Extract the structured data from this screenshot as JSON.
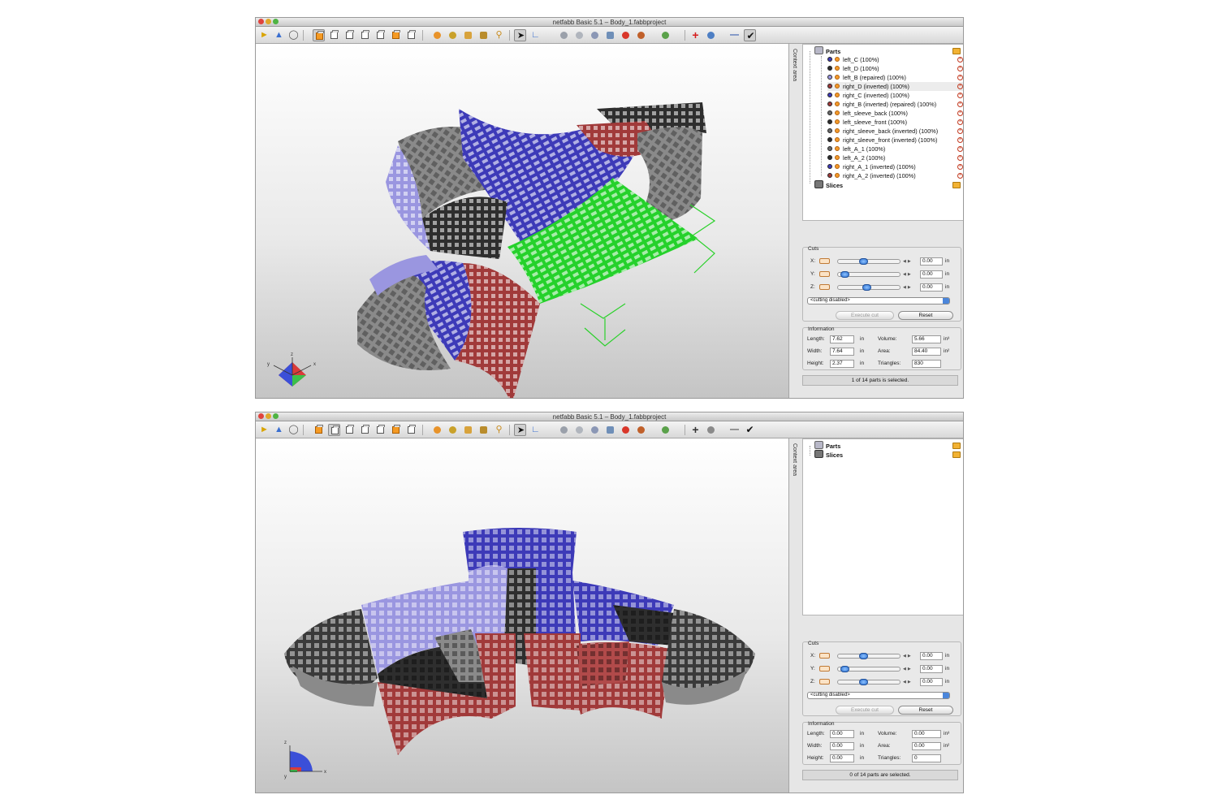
{
  "colors": {
    "red_part": "#a13a3a",
    "blue_part": "#3d3ab8",
    "lavender_part": "#9a96e0",
    "gray_part": "#8a8a8a",
    "dark_part": "#2e2e2e",
    "green_selected": "#25d12b",
    "accent": "#2a6fd0"
  },
  "toolbar_icons": [
    "open-icon",
    "shapes-icon",
    "add-part-icon",
    "view-front-icon",
    "view-back-icon",
    "view-left-icon",
    "view-right-icon",
    "view-top-icon",
    "view-bottom-icon",
    "zoom-all-icon",
    "zoom-selection-icon",
    "zoom-icon",
    "select-icon",
    "measure-icon",
    "rotate-icon",
    "move-icon",
    "scale-icon",
    "mesh-icon",
    "color-icon",
    "shading-icon",
    "repair-icon",
    "add-icon",
    "settings-icon",
    "minus-icon",
    "check-icon"
  ],
  "windows": [
    {
      "title": "netfabb Basic 5.1 – Body_1.fabbproject",
      "context_label": "Context area",
      "tree": {
        "parts_label": "Parts",
        "slices_label": "Slices",
        "parts": [
          {
            "name": "left_C (100%)",
            "color": "#3d3ab8"
          },
          {
            "name": "left_D (100%)",
            "color": "#2e2e2e"
          },
          {
            "name": "left_B (repaired) (100%)",
            "color": "#9a96e0"
          },
          {
            "name": "right_D (inverted) (100%)",
            "color": "#a13a3a",
            "selected": true
          },
          {
            "name": "right_C (inverted) (100%)",
            "color": "#3d3ab8"
          },
          {
            "name": "right_B (inverted) (repaired) (100%)",
            "color": "#a13a3a"
          },
          {
            "name": "left_sleeve_back (100%)",
            "color": "#6a6a6a"
          },
          {
            "name": "left_sleeve_front (100%)",
            "color": "#2e2e2e"
          },
          {
            "name": "right_sleeve_back (inverted) (100%)",
            "color": "#6a6a6a"
          },
          {
            "name": "right_sleeve_front (inverted) (100%)",
            "color": "#2e2e2e"
          },
          {
            "name": "left_A_1 (100%)",
            "color": "#6a6a6a"
          },
          {
            "name": "left_A_2 (100%)",
            "color": "#2e2e2e"
          },
          {
            "name": "right_A_1 (inverted) (100%)",
            "color": "#3d3ab8"
          },
          {
            "name": "right_A_2 (inverted) (100%)",
            "color": "#a13a3a"
          }
        ]
      },
      "cuts": {
        "title": "Cuts",
        "x_label": "X:",
        "x_value": "0.00",
        "x_unit": "in",
        "x_pos": 0.4,
        "y_label": "Y:",
        "y_value": "0.00",
        "y_unit": "in",
        "y_pos": 0.05,
        "z_label": "Z:",
        "z_value": "0.00",
        "z_unit": "in",
        "z_pos": 0.45,
        "mode": "<cutting disabled>",
        "execute_label": "Execute cut",
        "reset_label": "Reset"
      },
      "information": {
        "title": "Information",
        "length_label": "Length:",
        "length": "7.62",
        "width_label": "Width:",
        "width": "7.64",
        "height_label": "Height:",
        "height": "2.37",
        "volume_label": "Volume:",
        "volume": "5.66",
        "area_label": "Area:",
        "area": "84.40",
        "triangles_label": "Triangles:",
        "triangles": "830",
        "unit": "in",
        "volume_unit": "in³",
        "area_unit": "in²"
      },
      "status": "1 of 14 parts is selected.",
      "axis": {
        "x": "x",
        "y": "y",
        "z": "z"
      }
    },
    {
      "title": "netfabb Basic 5.1 – Body_1.fabbproject",
      "context_label": "Context area",
      "tree": {
        "parts_label": "Parts",
        "slices_label": "Slices"
      },
      "cuts": {
        "title": "Cuts",
        "x_label": "X:",
        "x_value": "0.00",
        "x_unit": "in",
        "x_pos": 0.4,
        "y_label": "Y:",
        "y_value": "0.00",
        "y_unit": "in",
        "y_pos": 0.05,
        "z_label": "Z:",
        "z_value": "0.00",
        "z_unit": "in",
        "z_pos": 0.4,
        "mode": "<cutting disabled>",
        "execute_label": "Execute cut",
        "reset_label": "Reset"
      },
      "information": {
        "title": "Information",
        "length_label": "Length:",
        "length": "0.00",
        "width_label": "Width:",
        "width": "0.00",
        "height_label": "Height:",
        "height": "0.00",
        "volume_label": "Volume:",
        "volume": "0.00",
        "area_label": "Area:",
        "area": "0.00",
        "triangles_label": "Triangles:",
        "triangles": "0",
        "unit": "in",
        "volume_unit": "in³",
        "area_unit": "in²"
      },
      "status": "0 of 14 parts are selected.",
      "axis": {
        "x": "x",
        "y": "y",
        "z": "z"
      }
    }
  ]
}
